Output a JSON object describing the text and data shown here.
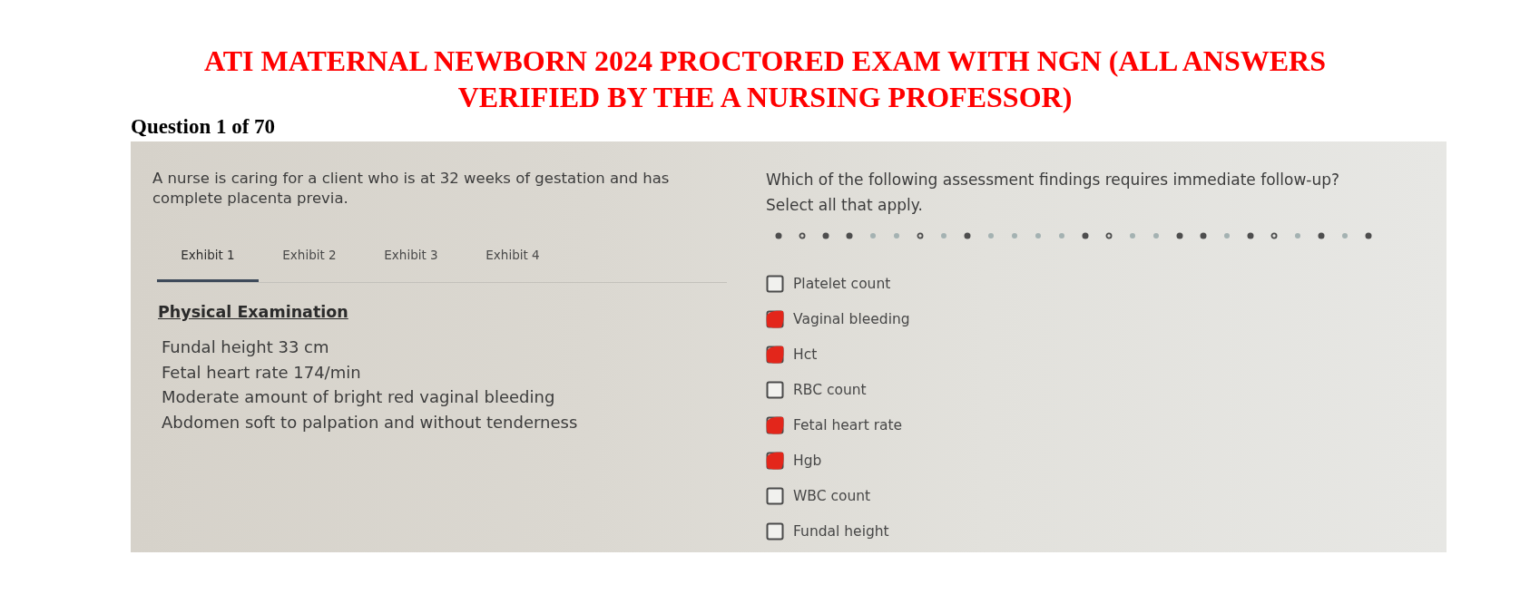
{
  "document": {
    "title": "ATI MATERNAL NEWBORN 2024 PROCTORED EXAM WITH NGN (ALL ANSWERS VERIFIED BY THE A NURSING PROFESSOR)",
    "question_label": "Question 1 of 70"
  },
  "case": {
    "stem": "A nurse is caring for a client who is at 32 weeks of gestation and has complete placenta previa.",
    "tabs": [
      {
        "label": "Exhibit 1",
        "selected": true
      },
      {
        "label": "Exhibit 2",
        "selected": false
      },
      {
        "label": "Exhibit 3",
        "selected": false
      },
      {
        "label": "Exhibit 4",
        "selected": false
      }
    ],
    "exhibit": {
      "heading": "Physical Examination",
      "findings": [
        "Fundal height 33 cm",
        "Fetal heart rate 174/min",
        "Moderate amount of bright red vaginal bleeding",
        "Abdomen soft to palpation and without tenderness"
      ]
    }
  },
  "question": {
    "prompt": "Which of the following assessment findings requires immediate follow-up?",
    "instruction": "Select all that apply.",
    "progress_dots": [
      {
        "kind": "filled"
      },
      {
        "kind": "ring"
      },
      {
        "kind": "filled"
      },
      {
        "kind": "filled"
      },
      {
        "kind": "faint"
      },
      {
        "kind": "faint"
      },
      {
        "kind": "ring"
      },
      {
        "kind": "faint"
      },
      {
        "kind": "filled"
      },
      {
        "kind": "faint"
      },
      {
        "kind": "faint"
      },
      {
        "kind": "faint"
      },
      {
        "kind": "faint"
      },
      {
        "kind": "filled"
      },
      {
        "kind": "ring"
      },
      {
        "kind": "faint"
      },
      {
        "kind": "faint"
      },
      {
        "kind": "filled"
      },
      {
        "kind": "filled"
      },
      {
        "kind": "faint"
      },
      {
        "kind": "filled"
      },
      {
        "kind": "ring"
      },
      {
        "kind": "faint"
      },
      {
        "kind": "filled"
      },
      {
        "kind": "faint"
      },
      {
        "kind": "filled"
      }
    ],
    "options": [
      {
        "label": "Platelet count",
        "checked": false
      },
      {
        "label": "Vaginal bleeding",
        "checked": true
      },
      {
        "label": "Hct",
        "checked": true
      },
      {
        "label": "RBC count",
        "checked": false
      },
      {
        "label": "Fetal heart rate",
        "checked": true
      },
      {
        "label": "Hgb",
        "checked": true
      },
      {
        "label": "WBC count",
        "checked": false
      },
      {
        "label": "Fundal height",
        "checked": false
      }
    ]
  }
}
